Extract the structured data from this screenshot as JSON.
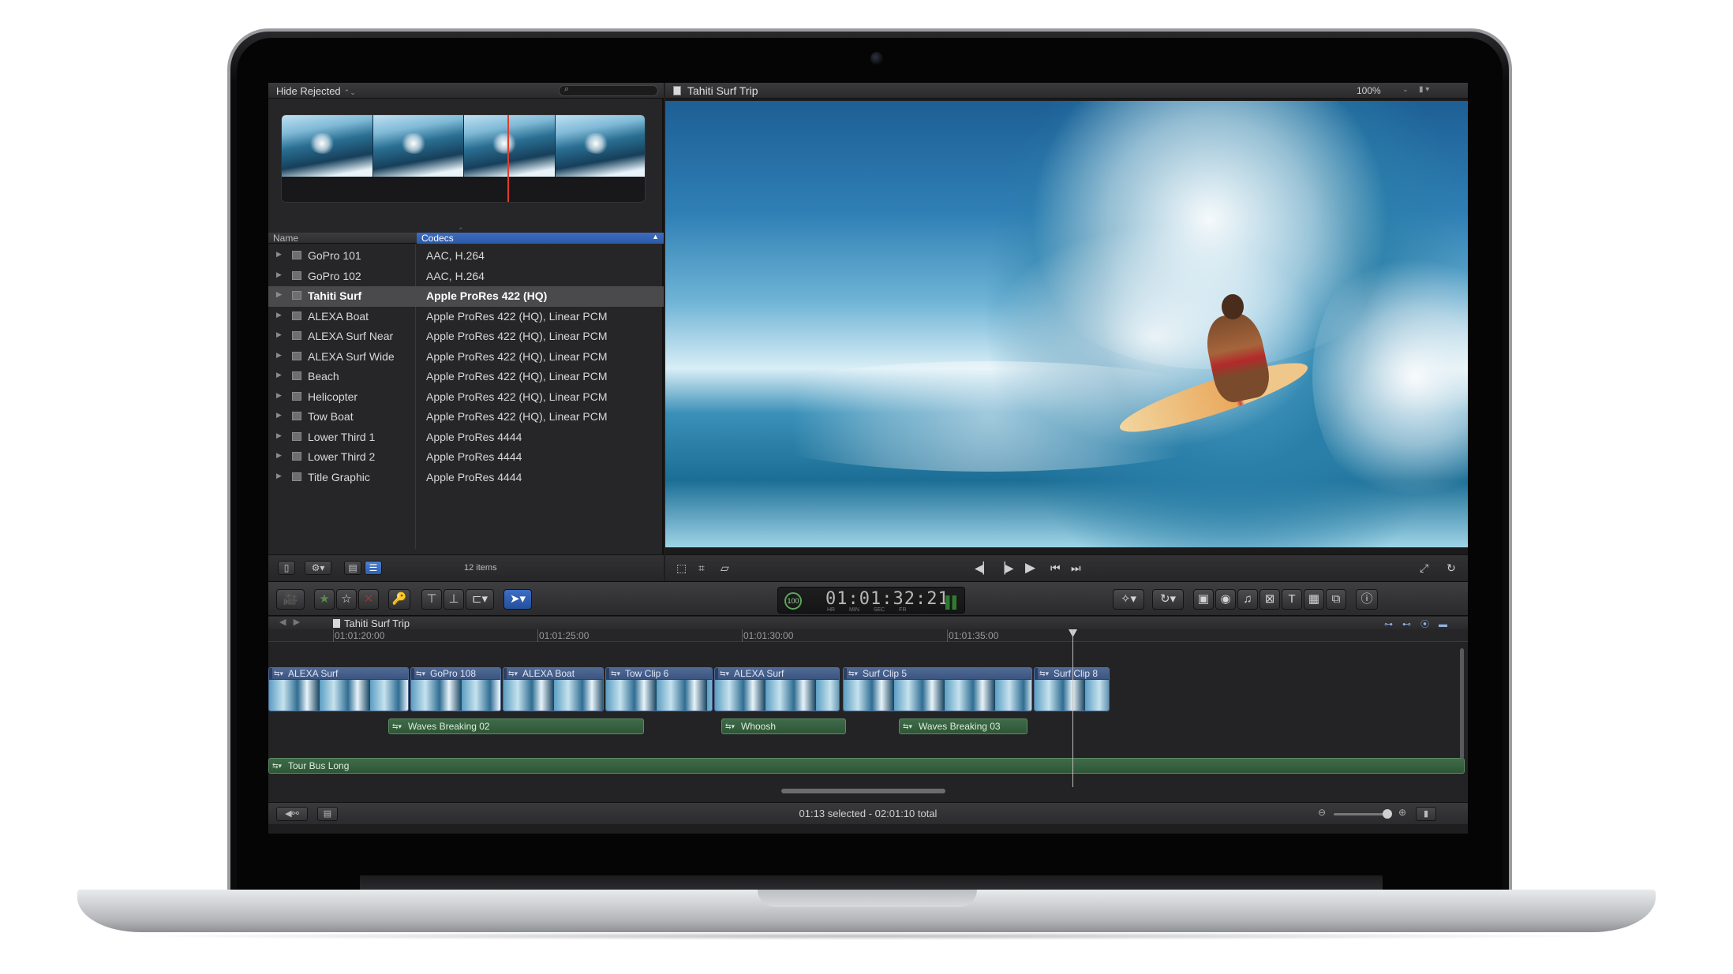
{
  "browser": {
    "filter_label": "Hide Rejected",
    "filter_chevron": "⌃⌄",
    "search_placeholder": "",
    "columns": {
      "name": "Name",
      "codecs": "Codecs"
    },
    "clips": [
      {
        "name": "GoPro 101",
        "codec": "AAC, H.264"
      },
      {
        "name": "GoPro 102",
        "codec": "AAC, H.264"
      },
      {
        "name": "Tahiti Surf",
        "codec": "Apple ProRes 422 (HQ)",
        "selected": true
      },
      {
        "name": "ALEXA Boat",
        "codec": "Apple ProRes 422 (HQ), Linear PCM"
      },
      {
        "name": "ALEXA Surf Near",
        "codec": "Apple ProRes 422 (HQ), Linear PCM"
      },
      {
        "name": "ALEXA Surf Wide",
        "codec": "Apple ProRes 422 (HQ), Linear PCM"
      },
      {
        "name": "Beach",
        "codec": "Apple ProRes 422 (HQ), Linear PCM"
      },
      {
        "name": "Helicopter",
        "codec": "Apple ProRes 422 (HQ), Linear PCM"
      },
      {
        "name": "Tow Boat",
        "codec": "Apple ProRes 422 (HQ), Linear PCM"
      },
      {
        "name": "Lower Third 1",
        "codec": "Apple ProRes 4444"
      },
      {
        "name": "Lower Third 2",
        "codec": "Apple ProRes 4444"
      },
      {
        "name": "Title Graphic",
        "codec": "Apple ProRes 4444"
      }
    ],
    "items_count": "12 items"
  },
  "viewer": {
    "title": "Tahiti Surf Trip",
    "zoom": "100%"
  },
  "toolbar": {
    "timecode": "01:01:32:21",
    "timecode_units": "HR MIN SEC FR",
    "badge": "100"
  },
  "timeline": {
    "title": "Tahiti Surf Trip",
    "ruler_labels": [
      "01:01:20:00",
      "01:01:25:00",
      "01:01:30:00",
      "01:01:35:00"
    ],
    "video_clips": [
      "ALEXA Surf",
      "GoPro 108",
      "ALEXA Boat",
      "Tow Clip 6",
      "ALEXA Surf",
      "Surf Clip 5",
      "Surf Clip 8"
    ],
    "audio_clips": [
      "Waves Breaking 02",
      "Whoosh",
      "Waves Breaking 03"
    ],
    "music_clip": "Tour Bus Long",
    "status": "01:13 selected - 02:01:10 total"
  },
  "colors": {
    "selection_blue": "#3e6cc0",
    "video_clip": "#2b3f63",
    "audio_clip": "#3f6b49",
    "playhead_red": "#e23b2e"
  }
}
